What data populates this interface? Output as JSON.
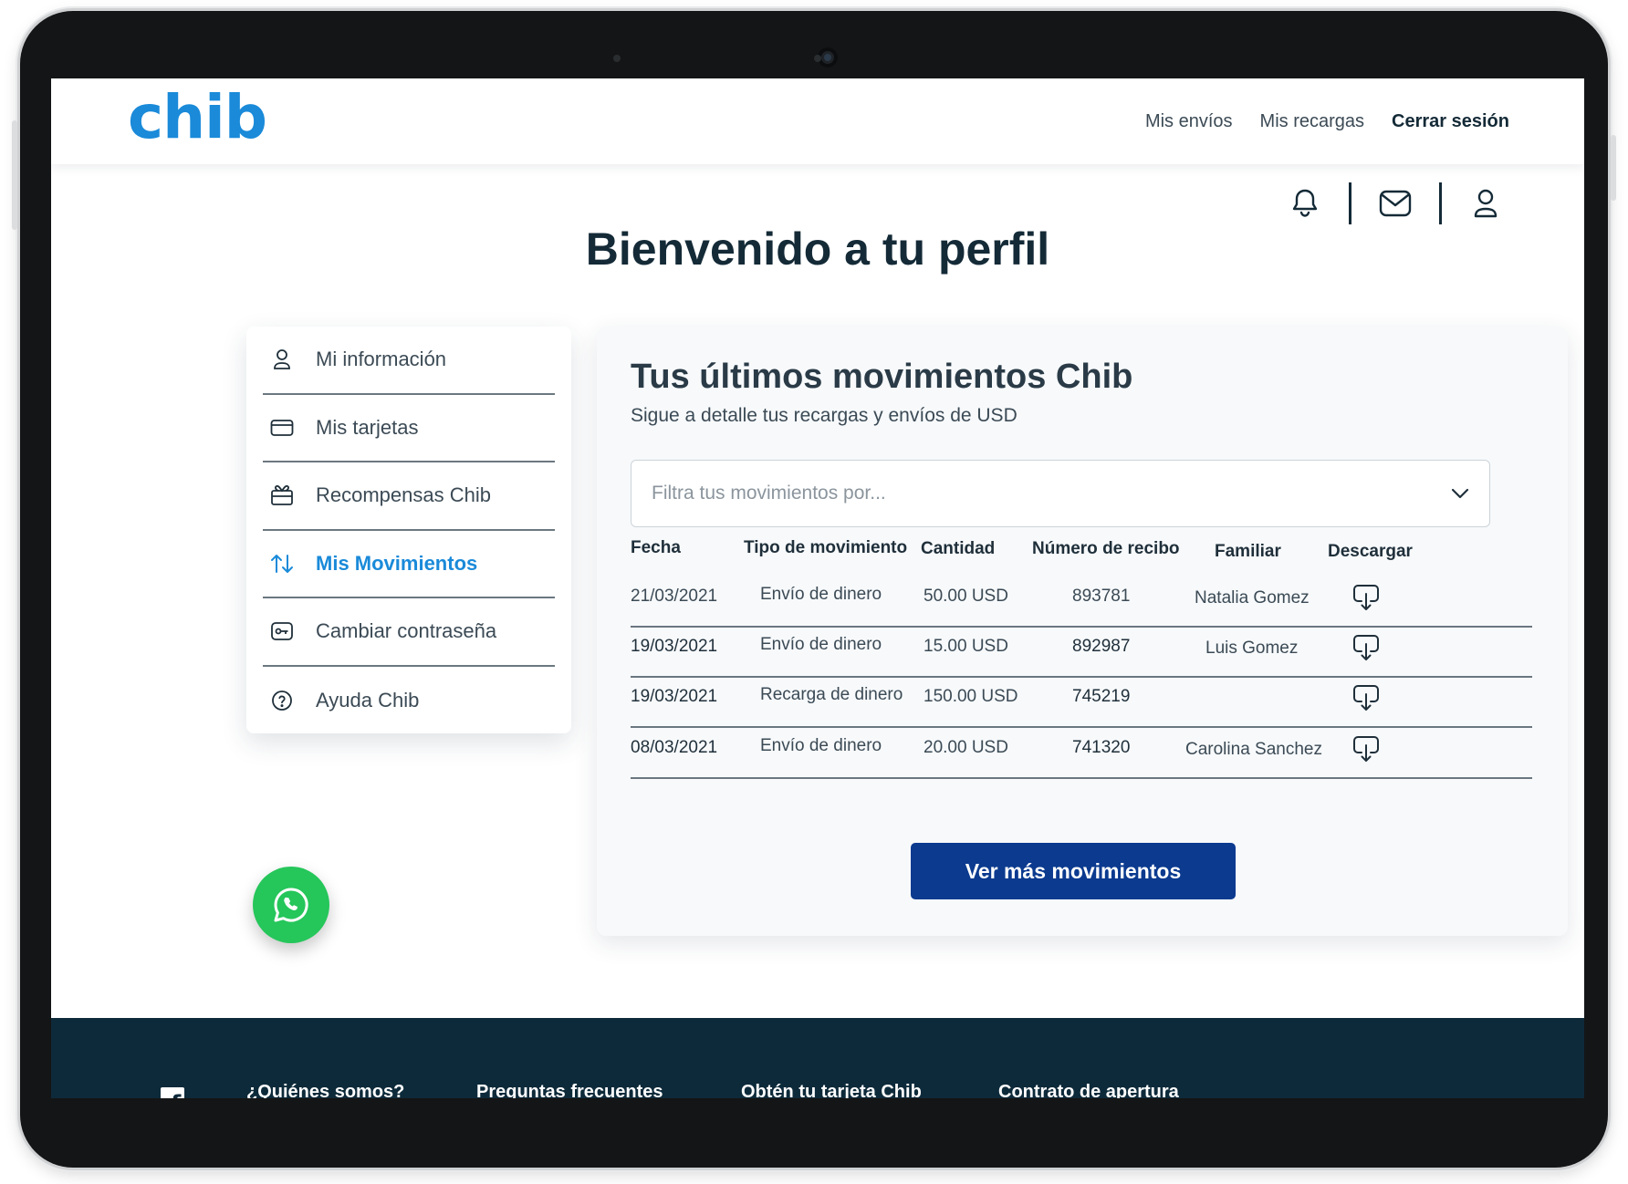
{
  "header": {
    "logo": "chib",
    "nav": [
      "Mis envíos",
      "Mis recargas",
      "Cerrar sesión"
    ]
  },
  "icons": [
    "bell-icon",
    "mail-icon",
    "user-icon"
  ],
  "page_title": "Bienvenido a tu perfil",
  "side_menu": [
    {
      "label": "Mi información",
      "icon": "user-icon"
    },
    {
      "label": "Mis tarjetas",
      "icon": "card-icon"
    },
    {
      "label": "Recompensas Chib",
      "icon": "gift-icon"
    },
    {
      "label": "Mis Movimientos",
      "icon": "arrows-updown-icon",
      "active": true
    },
    {
      "label": "Cambiar contraseña",
      "icon": "key-icon"
    },
    {
      "label": "Ayuda Chib",
      "icon": "help-icon"
    }
  ],
  "card": {
    "title": "Tus últimos movimientos Chib",
    "subtitle": "Sigue a detalle tus recargas y envíos de USD",
    "filter_placeholder": "Filtra tus movimientos por...",
    "columns": [
      "Fecha",
      "Tipo de movimiento",
      "Cantidad",
      "Número de recibo",
      "Familiar",
      "Descargar"
    ],
    "rows": [
      {
        "fecha": "21/03/2021",
        "tipo": "Envío de dinero",
        "cantidad": "50.00 USD",
        "recibo": "893781",
        "familiar": "Natalia Gomez"
      },
      {
        "fecha": "19/03/2021",
        "tipo": "Envío de dinero",
        "cantidad": "15.00 USD",
        "recibo": "892987",
        "familiar": "Luis Gomez"
      },
      {
        "fecha": "19/03/2021",
        "tipo": "Recarga de dinero",
        "cantidad": "150.00 USD",
        "recibo": "745219",
        "familiar": ""
      },
      {
        "fecha": "08/03/2021",
        "tipo": "Envío de dinero",
        "cantidad": "20.00 USD",
        "recibo": "741320",
        "familiar": "Carolina Sanchez"
      }
    ],
    "more_button": "Ver más movimientos"
  },
  "footer": {
    "links": [
      "¿Quiénes somos?",
      "Preguntas frecuentes",
      "Obtén tu tarjeta Chib",
      "Contrato de apertura"
    ]
  },
  "colors": {
    "brand": "#1a8ad9",
    "primary_button": "#0b3a8f",
    "footer": "#0d2a3a",
    "whatsapp": "#25c65a"
  }
}
